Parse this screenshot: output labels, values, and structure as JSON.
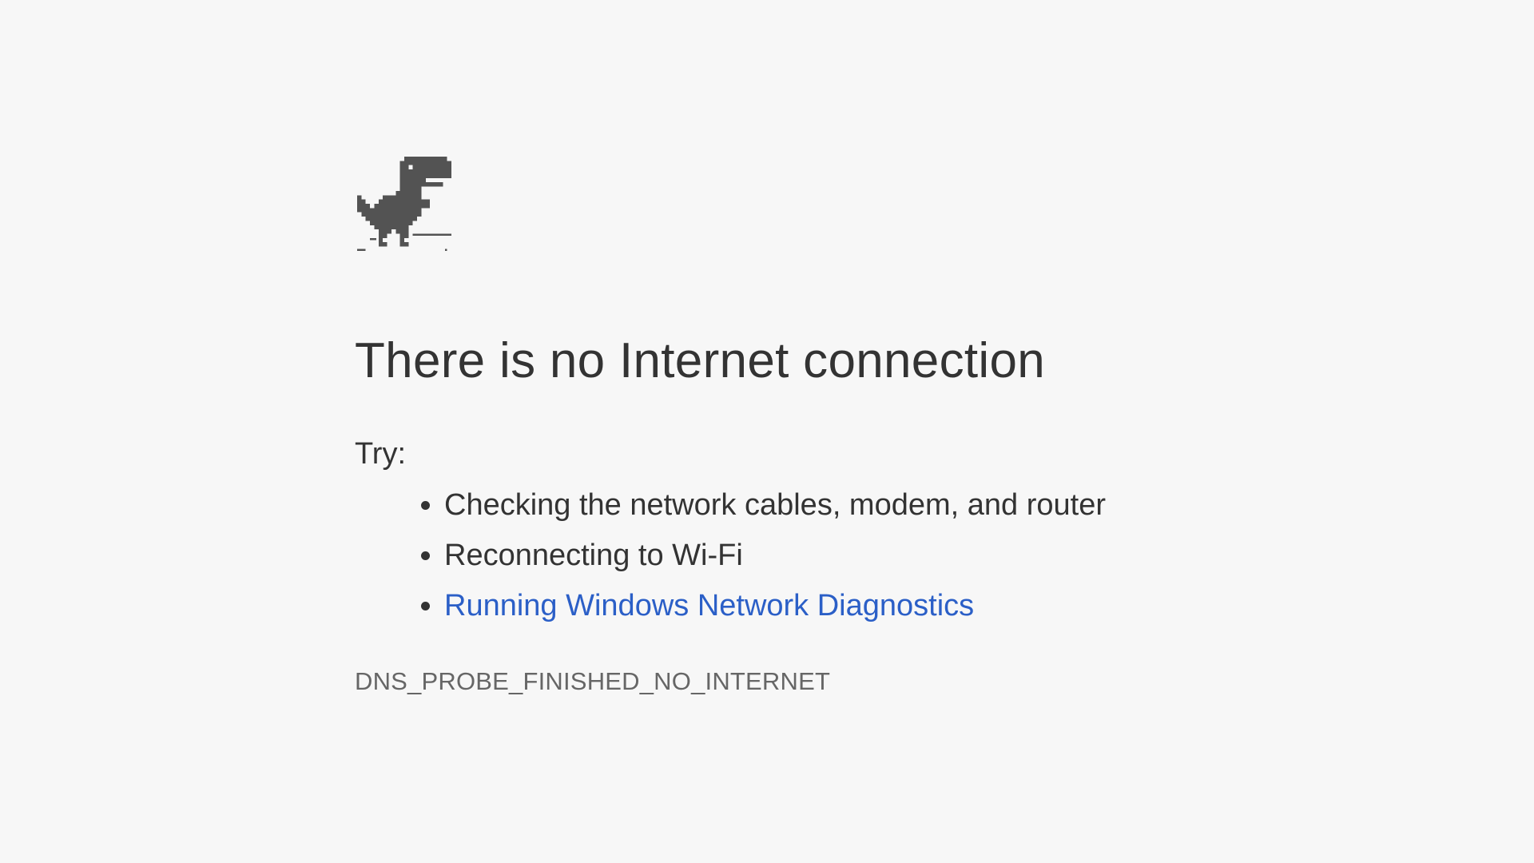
{
  "icons": {
    "offline_icon": "pixel-dinosaur-icon"
  },
  "colors": {
    "background": "#f7f7f7",
    "text": "#333333",
    "link": "#2b5fc7",
    "error_code": "#666666",
    "dino": "#535353"
  },
  "main": {
    "title": "There is no Internet connection",
    "try_label": "Try:",
    "suggestions": [
      {
        "label": "Checking the network cables, modem, and router"
      },
      {
        "label": "Reconnecting to Wi-Fi"
      },
      {
        "label": "Running Windows Network Diagnostics"
      }
    ],
    "error_code": "DNS_PROBE_FINISHED_NO_INTERNET"
  }
}
